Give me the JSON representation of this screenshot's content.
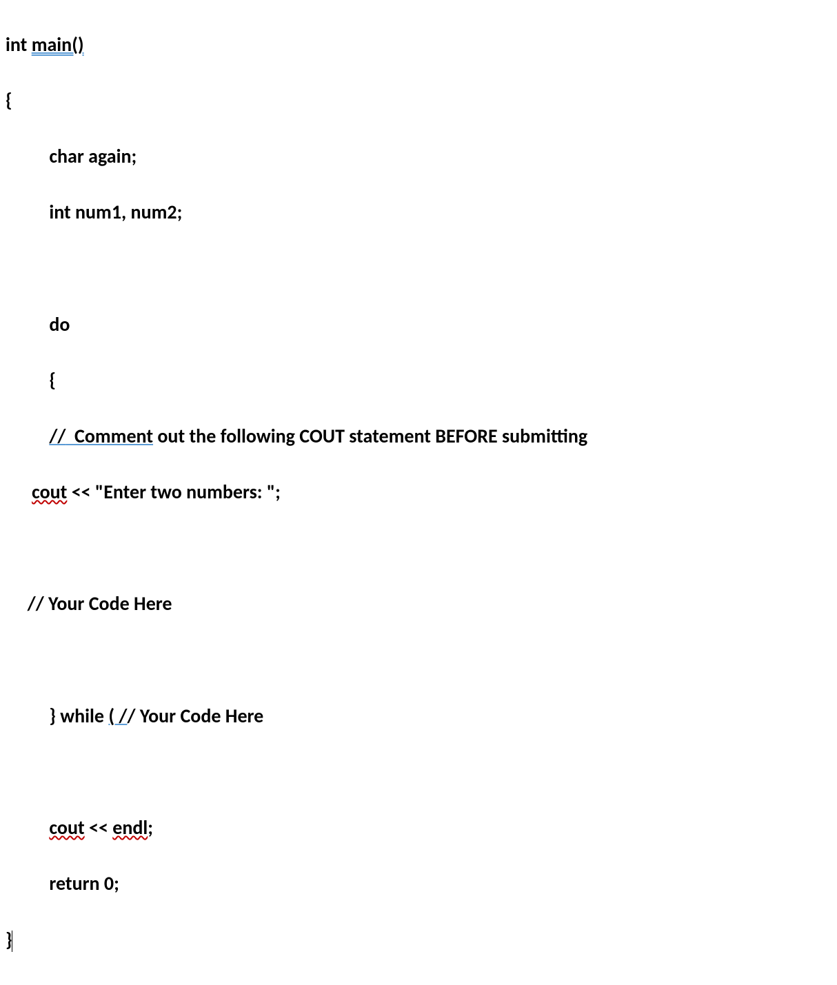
{
  "code": {
    "l1_int": "int ",
    "l1_main": "main()",
    "l2_brace": "{",
    "l3": "char again;",
    "l4": "int num1, num2;",
    "l5": "do",
    "l6_brace": "{",
    "l7_slash": "//",
    "l7_comment": "  Comment",
    "l7_rest": " out the following COUT statement BEFORE submitting",
    "l8_cout": "cout",
    "l8_rest": " << \"Enter two numbers: \";",
    "l9": "// Your Code Here",
    "l10_part1": "} while ",
    "l10_paren": "( /",
    "l10_rest": "/ Your Code Here",
    "l11_cout": "cout",
    "l11_arrows": " << ",
    "l11_endl": "endl",
    "l11_semi": ";",
    "l12": "return 0;",
    "l13_brace": "}"
  }
}
